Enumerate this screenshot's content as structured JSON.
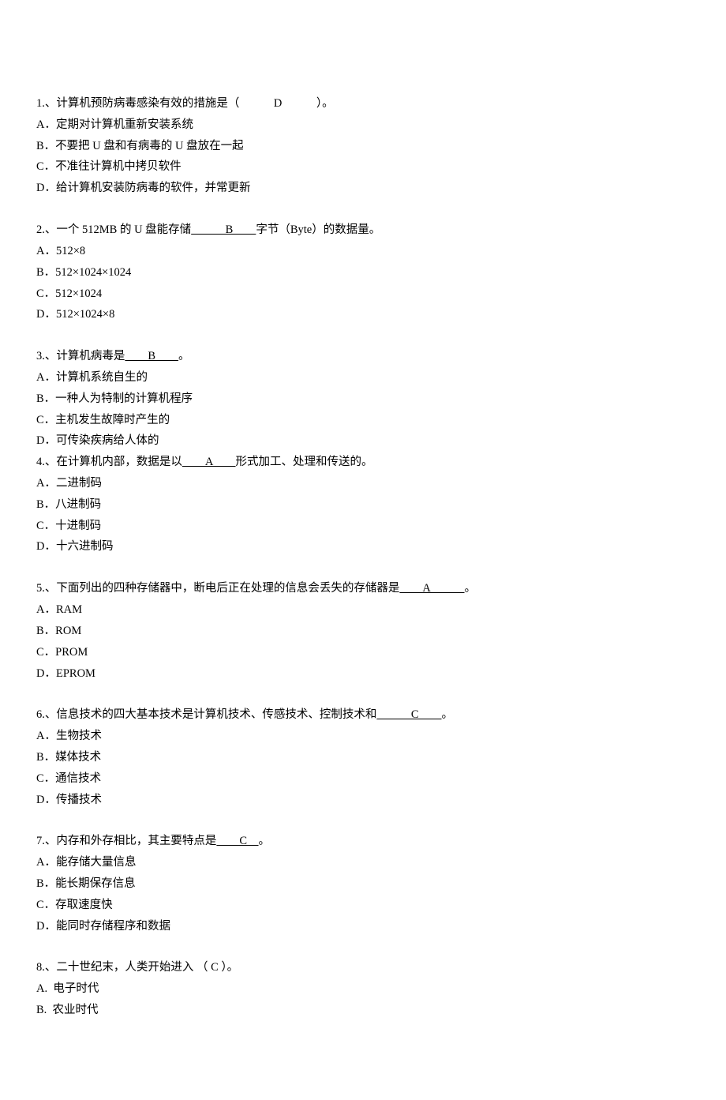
{
  "questions": [
    {
      "stem_pre": "1.、计算机预防病毒感染有效的措施是（　　　",
      "stem_ans": "D",
      "stem_post": "　　　）。",
      "underline_ans": false,
      "options": [
        "A．定期对计算机重新安装系统",
        "B．不要把 U 盘和有病毒的 U 盘放在一起",
        "C．不准往计算机中拷贝软件",
        "D．给计算机安装防病毒的软件，并常更新"
      ]
    },
    {
      "stem_pre": "2.、一个 512MB 的 U 盘能存储",
      "stem_ans": "　　　B　　",
      "stem_post": "字节（Byte）的数据量。",
      "underline_ans": true,
      "options": [
        "A．512×8",
        "B．512×1024×1024",
        "C．512×1024",
        "D．512×1024×8"
      ]
    },
    {
      "stem_pre": "3.、计算机病毒是",
      "stem_ans": "　　B　　",
      "stem_post": "。",
      "underline_ans": true,
      "options": [
        "A．计算机系统自生的",
        "B．一种人为特制的计算机程序",
        "C．主机发生故障时产生的",
        "D．可传染疾病给人体的"
      ],
      "followup": {
        "stem_pre": "4.、在计算机内部，数据是以",
        "stem_ans": "　　A　　",
        "stem_post": "形式加工、处理和传送的。",
        "underline_ans": true,
        "options": [
          "A．二进制码",
          "B．八进制码",
          "C．十进制码",
          "D．十六进制码"
        ]
      }
    },
    {
      "stem_pre": "5.、下面列出的四种存储器中，断电后正在处理的信息会丢失的存储器是",
      "stem_ans": "　　A　　　",
      "stem_post": "。",
      "underline_ans": true,
      "options": [
        "A．RAM",
        "B．ROM",
        "C．PROM",
        "D．EPROM"
      ]
    },
    {
      "stem_pre": "6.、信息技术的四大基本技术是计算机技术、传感技术、控制技术和",
      "stem_ans": "　　　C　　",
      "stem_post": "。",
      "underline_ans": true,
      "options": [
        "A．生物技术",
        "B．媒体技术",
        "C．通信技术",
        "D．传播技术"
      ]
    },
    {
      "stem_pre": "7.、内存和外存相比，其主要特点是",
      "stem_ans": "　　C　",
      "stem_post": "。",
      "underline_ans": true,
      "options": [
        "A．能存储大量信息",
        "B．能长期保存信息",
        "C．存取速度快",
        "D．能同时存储程序和数据"
      ]
    },
    {
      "stem_pre": "8.、二十世纪末，人类开始进入 （ C ）。",
      "stem_ans": "",
      "stem_post": "",
      "underline_ans": false,
      "options": [
        "A.  电子时代",
        "B.  农业时代"
      ]
    }
  ]
}
